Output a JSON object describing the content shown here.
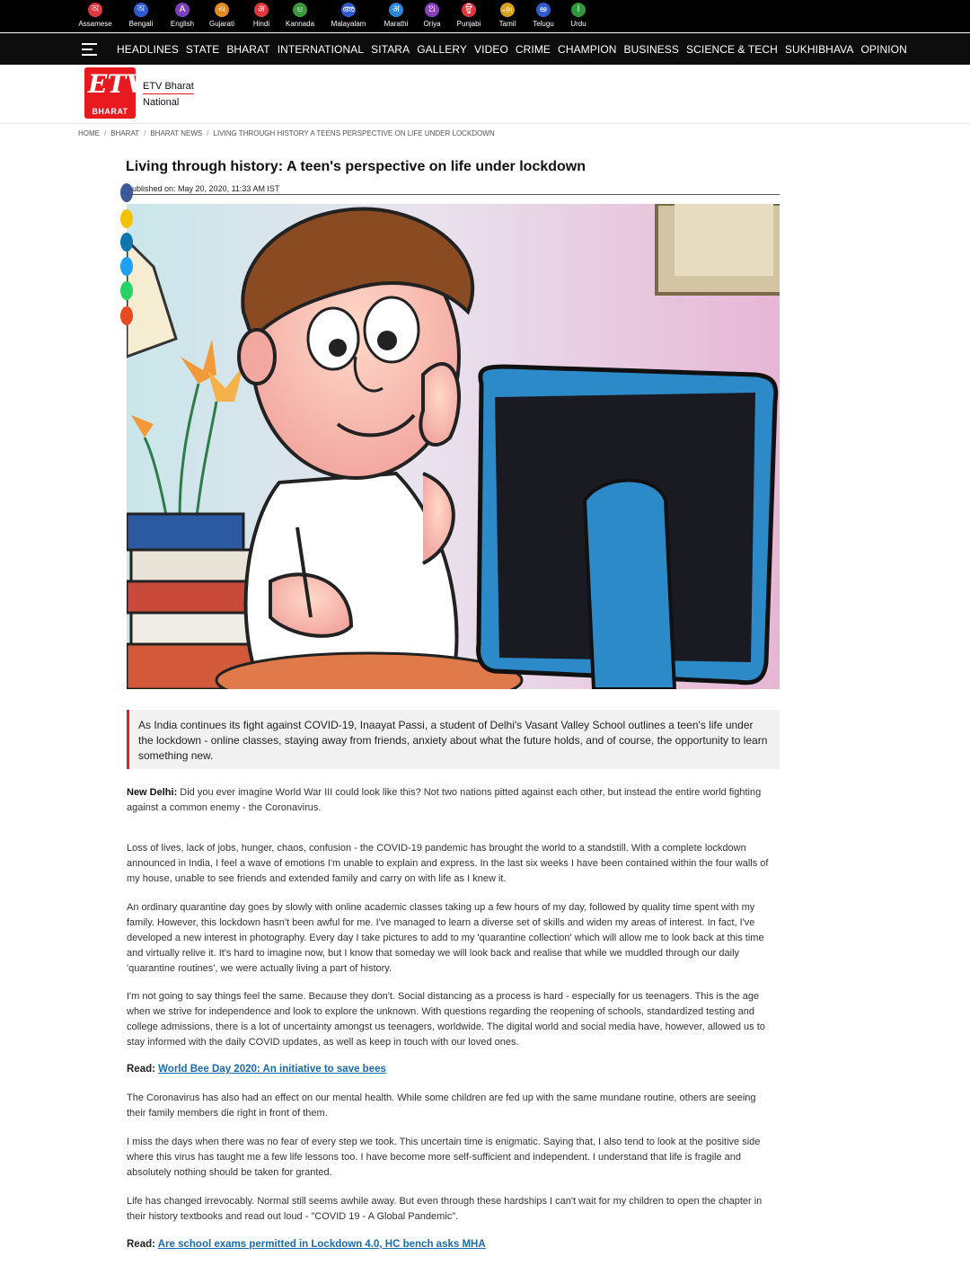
{
  "languages": [
    {
      "glyph": "অ",
      "name": "Assamese",
      "color": "#e0383e"
    },
    {
      "glyph": "অ",
      "name": "Bengali",
      "color": "#2f5bd1"
    },
    {
      "glyph": "A",
      "name": "English",
      "color": "#7d3fbf"
    },
    {
      "glyph": "ચ",
      "name": "Gujarati",
      "color": "#e28a24"
    },
    {
      "glyph": "अ",
      "name": "Hindi",
      "color": "#e0383e"
    },
    {
      "glyph": "ಅ",
      "name": "Kannada",
      "color": "#3c9a3c"
    },
    {
      "glyph": "അ",
      "name": "Malayalam",
      "color": "#2f5bd1"
    },
    {
      "glyph": "अ",
      "name": "Marathi",
      "color": "#2f86d8"
    },
    {
      "glyph": "ଅ",
      "name": "Oriya",
      "color": "#8a3fbf"
    },
    {
      "glyph": "ਉ",
      "name": "Punjabi",
      "color": "#e0383e"
    },
    {
      "glyph": "அ",
      "name": "Tamil",
      "color": "#d9a21f"
    },
    {
      "glyph": "అ",
      "name": "Telugu",
      "color": "#2f5bd1"
    },
    {
      "glyph": "ا",
      "name": "Urdu",
      "color": "#2f9a3c"
    }
  ],
  "nav": [
    "HEADLINES",
    "STATE",
    "BHARAT",
    "INTERNATIONAL",
    "SITARA",
    "GALLERY",
    "VIDEO",
    "CRIME",
    "CHAMPION",
    "BUSINESS",
    "SCIENCE & TECH",
    "SUKHIBHAVA",
    "OPINION"
  ],
  "header": {
    "logo_text": "ETV",
    "logo_sub": "BHARAT",
    "brand": "ETV Bharat",
    "section": "National"
  },
  "breadcrumb": [
    "HOME",
    "BHARAT",
    "BHARAT NEWS",
    "LIVING THROUGH HISTORY A TEENS PERSPECTIVE ON LIFE UNDER LOCKDOWN"
  ],
  "article": {
    "title": "Living through history: A teen's perspective on life under lockdown",
    "published": "Published on: May 20, 2020, 11:33 AM IST",
    "summary": "As India continues its fight against COVID-19, Inaayat Passi, a student of Delhi's Vasant Valley School outlines a teen's life under the lockdown - online classes, staying away from friends, anxiety about what the future holds, and of course, the opportunity to learn something new.",
    "dateline": "New Delhi:",
    "p1": "Did you ever imagine World War III could look like this? Not two nations pitted against each other, but instead the entire world fighting against a common enemy - the Coronavirus.",
    "p2": "Loss of lives, lack of jobs, hunger, chaos, confusion - the COVID-19 pandemic has brought the world to a standstill. With a complete lockdown announced in India, I feel a wave of emotions I'm unable to explain and express. In the last six weeks I have been contained within the four walls of my house, unable to see friends and extended family and carry on with life as I knew it.",
    "p3": "An ordinary quarantine day goes by slowly with online academic classes taking up a few hours of my day, followed by quality time spent with my family. However, this lockdown hasn't been awful for me. I've managed to learn a diverse set of skills and widen my areas of interest. In fact, I've developed a new interest in photography. Every day I take pictures to add to my 'quarantine collection' which will allow me to look back at this time and virtually relive it. It's hard to imagine now, but I know that someday we will look back and realise that while we muddled through our daily 'quarantine routines', we were actually living a part of history.",
    "p4": "I'm not going to say things feel the same. Because they don't. Social distancing as a process is hard - especially for us teenagers. This is the age when we strive for independence and look to explore the unknown. With questions regarding the reopening of schools, standardized testing and college admissions, there is a lot of uncertainty amongst us teenagers, worldwide. The digital world and social media have, however, allowed us to stay informed with the daily COVID updates, as well as keep in touch with our loved ones.",
    "read_label": "Read:",
    "read1": "World Bee Day 2020: An initiative to save bees",
    "p5": "The Coronavirus has also had an effect on our mental health. While some children are fed up with the same mundane routine, others are seeing their family members die right in front of them.",
    "p6": "I miss the days when there was no fear of every step we took. This uncertain time is enigmatic. Saying that, I also tend to look at the positive side where this virus has taught me a few life lessons too. I have become more self-sufficient and independent. I understand that life is fragile and absolutely nothing should be taken for granted.",
    "p7": "Life has changed irrevocably. Normal still seems awhile away. But even through these hardships I can't wait for my children to open the chapter in their history textbooks and read out loud - \"COVID 19 - A Global Pandemic\".",
    "read2": "Are school exams permitted in Lockdown 4.0, HC bench asks MHA"
  },
  "share_buttons": [
    {
      "icon": "facebook-icon",
      "color": "#3b5998"
    },
    {
      "icon": "share-icon",
      "color": "#f2c200"
    },
    {
      "icon": "linkedin-icon",
      "color": "#0e76a8"
    },
    {
      "icon": "twitter-icon",
      "color": "#1da1f2"
    },
    {
      "icon": "whatsapp-icon",
      "color": "#25d366"
    },
    {
      "icon": "email-icon",
      "color": "#ea4a1f"
    }
  ]
}
